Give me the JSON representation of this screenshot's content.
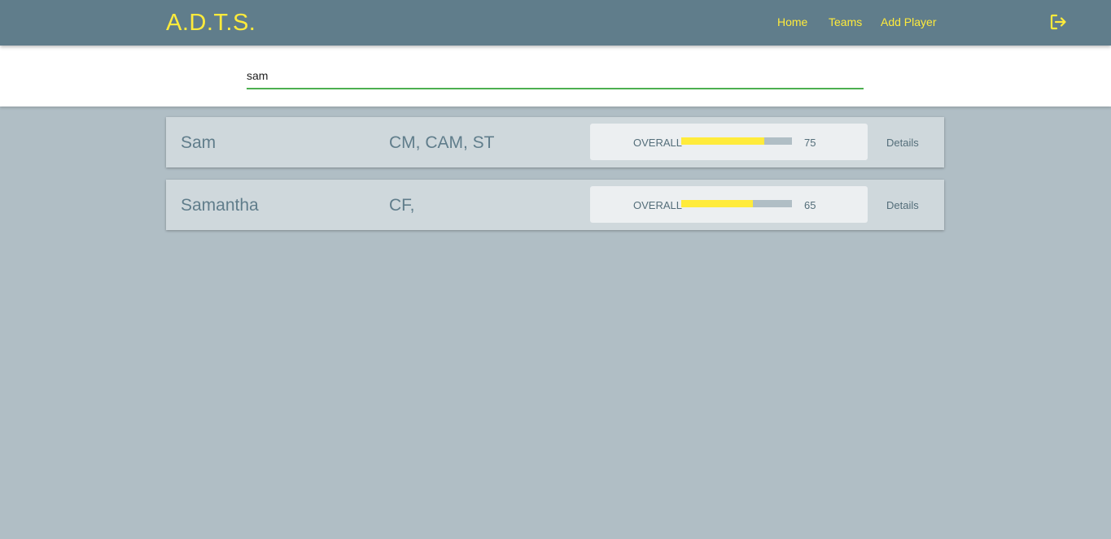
{
  "navbar": {
    "brand": "A.D.T.S.",
    "links": [
      {
        "label": "Home"
      },
      {
        "label": "Teams"
      },
      {
        "label": "Add Player"
      }
    ],
    "logout_icon": "logout-icon",
    "background_color": "#607d8b",
    "accent_color": "#ffeb3b"
  },
  "search": {
    "value": "sam",
    "placeholder": ""
  },
  "players": [
    {
      "name": "Sam",
      "positions": "CM, CAM, ST",
      "overall_label": "OVERALL",
      "overall": 75,
      "details_label": "Details"
    },
    {
      "name": "Samantha",
      "positions": "CF,",
      "overall_label": "OVERALL",
      "overall": 65,
      "details_label": "Details"
    }
  ]
}
